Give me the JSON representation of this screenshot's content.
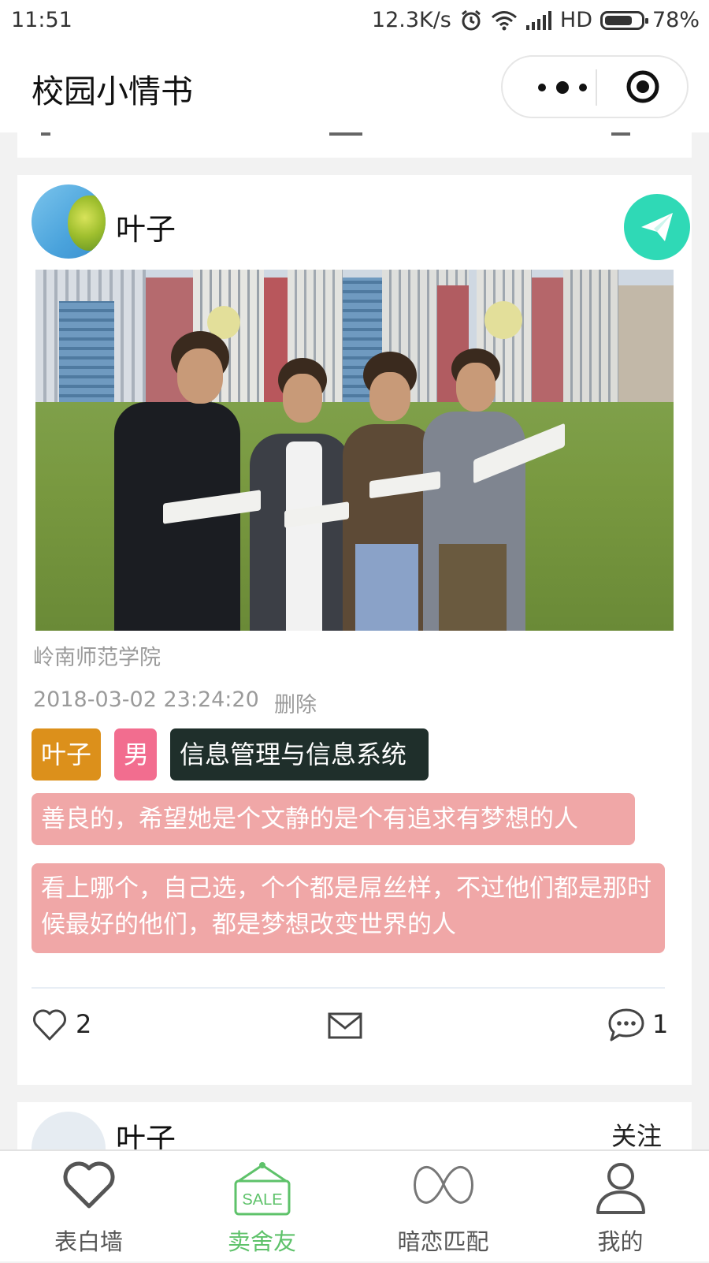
{
  "status_bar": {
    "time": "11:51",
    "net_speed": "12.3K/s",
    "network": "HD",
    "battery": "78%"
  },
  "nav": {
    "title": "校园小情书",
    "more_icon": "more-dots-icon",
    "close_icon": "target-circle-icon"
  },
  "post": {
    "username": "叶子",
    "school": "岭南师范学院",
    "timestamp": "2018-03-02 23:24:20",
    "delete_label": "删除",
    "tags": {
      "name": "叶子",
      "gender": "男",
      "major": "信息管理与信息系统"
    },
    "bubble1": "善良的，希望她是个文静的是个有追求有梦想的人",
    "bubble2": "看上哪个，自己选，个个都是屌丝样，不过他们都是那时候最好的他们，都是梦想改变世界的人",
    "likes": "2",
    "comments": "1",
    "colors": {
      "send": "#2fd9b6",
      "tag_name": "#dc901b",
      "tag_gender": "#f26d8f",
      "tag_major": "#1f2f2b",
      "bubble": "#f0a7a7"
    }
  },
  "next_post": {
    "username": "叶子",
    "follow_label": "关注"
  },
  "tabbar": {
    "items": [
      {
        "label": "表白墙",
        "icon": "heart-icon"
      },
      {
        "label": "卖舍友",
        "icon": "sale-sign-icon",
        "active": true
      },
      {
        "label": "暗恋匹配",
        "icon": "ribbon-icon"
      },
      {
        "label": "我的",
        "icon": "person-icon"
      }
    ],
    "active_color": "#5ec26a"
  }
}
